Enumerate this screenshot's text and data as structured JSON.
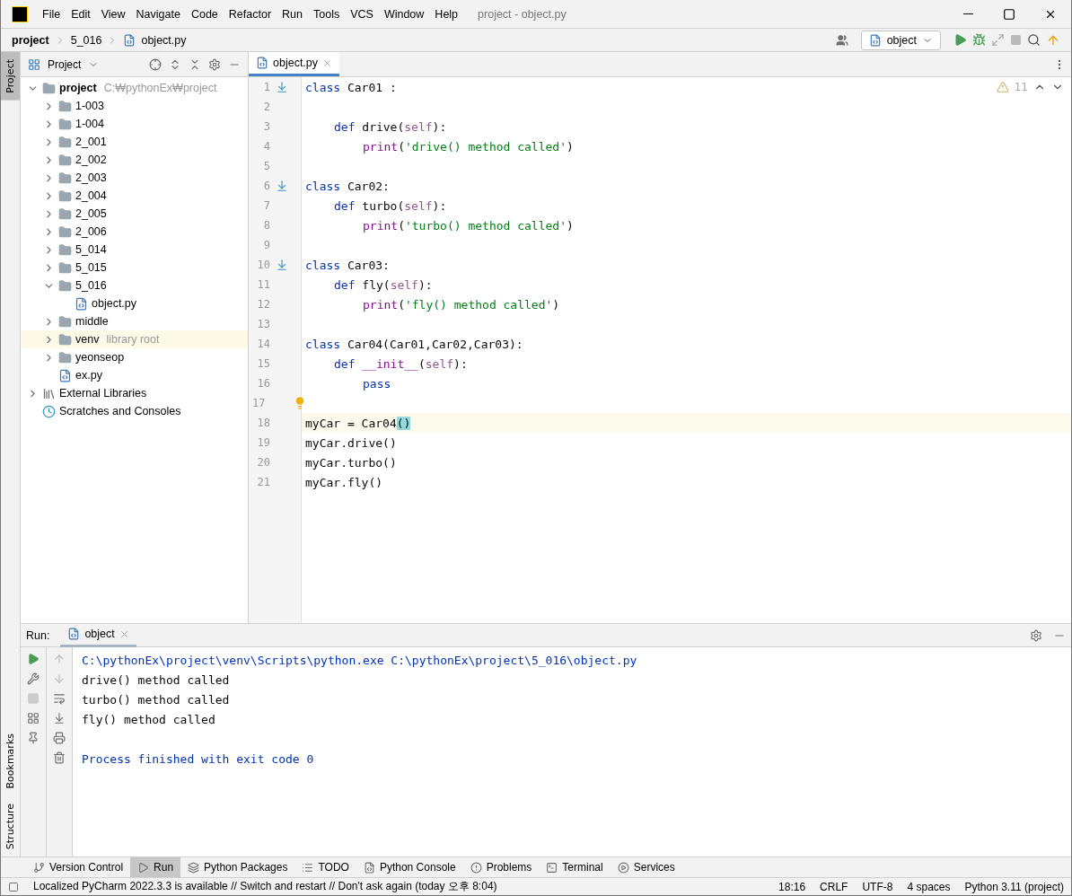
{
  "window": {
    "title": "project - object.py",
    "menu": [
      "File",
      "Edit",
      "View",
      "Navigate",
      "Code",
      "Refactor",
      "Run",
      "Tools",
      "VCS",
      "Window",
      "Help"
    ]
  },
  "breadcrumbs": [
    "project",
    "5_016",
    "object.py"
  ],
  "run_config": "object",
  "side_tabs_left": [
    {
      "label": "Project",
      "selected": true
    }
  ],
  "side_tabs_bottom": [
    "Bookmarks",
    "Structure"
  ],
  "project_panel": {
    "title": "Project",
    "tree": [
      {
        "kind": "folder",
        "name": "project",
        "hint": "C:₩pythonEx₩project",
        "expanded": true,
        "bold": true,
        "highlighted": false,
        "children": [
          {
            "kind": "folder",
            "name": "1-003",
            "expanded": false,
            "highlighted": false
          },
          {
            "kind": "folder",
            "name": "1-004",
            "expanded": false,
            "highlighted": false
          },
          {
            "kind": "folder",
            "name": "2_001",
            "expanded": false,
            "highlighted": false
          },
          {
            "kind": "folder",
            "name": "2_002",
            "expanded": false,
            "highlighted": false
          },
          {
            "kind": "folder",
            "name": "2_003",
            "expanded": false,
            "highlighted": false
          },
          {
            "kind": "folder",
            "name": "2_004",
            "expanded": false,
            "highlighted": false
          },
          {
            "kind": "folder",
            "name": "2_005",
            "expanded": false,
            "highlighted": false
          },
          {
            "kind": "folder",
            "name": "2_006",
            "expanded": false,
            "highlighted": false
          },
          {
            "kind": "folder",
            "name": "5_014",
            "expanded": false,
            "highlighted": false
          },
          {
            "kind": "folder",
            "name": "5_015",
            "expanded": false,
            "highlighted": false
          },
          {
            "kind": "folder",
            "name": "5_016",
            "expanded": true,
            "highlighted": false,
            "children": [
              {
                "kind": "python",
                "name": "object.py",
                "highlighted": false
              }
            ]
          },
          {
            "kind": "folder",
            "name": "middle",
            "expanded": false,
            "highlighted": false
          },
          {
            "kind": "folder",
            "name": "venv",
            "hint": "library root",
            "expanded": false,
            "highlighted": true
          },
          {
            "kind": "folder",
            "name": "yeonseop",
            "expanded": false,
            "highlighted": false
          },
          {
            "kind": "python",
            "name": "ex.py",
            "highlighted": false
          }
        ]
      },
      {
        "kind": "libraries",
        "name": "External Libraries",
        "expanded": false,
        "highlighted": false
      },
      {
        "kind": "scratches",
        "name": "Scratches and Consoles",
        "highlighted": false
      }
    ]
  },
  "editor": {
    "tabs": [
      {
        "label": "object.py",
        "selected": true
      }
    ],
    "warnings": "11",
    "lines": [
      {
        "number": "1",
        "kind": "top",
        "marker": true,
        "bulb": false,
        "current": false,
        "tokens": [
          {
            "kind": "keyword",
            "text": "class"
          },
          {
            "kind": "plain",
            "text": " Car01 :"
          }
        ]
      },
      {
        "number": "2",
        "marker": false,
        "bulb": false,
        "current": false
      },
      {
        "number": "3",
        "kind": "method",
        "marker": false,
        "bulb": false,
        "current": false,
        "tokens": [
          {
            "kind": "keyword",
            "text": "def"
          },
          {
            "kind": "plain",
            "text": " drive("
          },
          {
            "kind": "self",
            "text": "self"
          },
          {
            "kind": "plain",
            "text": "):"
          }
        ]
      },
      {
        "number": "4",
        "kind": "body",
        "marker": false,
        "bulb": false,
        "current": false,
        "tokens": [
          {
            "kind": "builtin",
            "text": "print"
          },
          {
            "kind": "plain",
            "text": "("
          },
          {
            "kind": "string",
            "text": "'drive() method called'"
          },
          {
            "kind": "plain",
            "text": ")"
          }
        ]
      },
      {
        "number": "5",
        "marker": false,
        "bulb": false,
        "current": false
      },
      {
        "number": "6",
        "kind": "top",
        "marker": true,
        "bulb": false,
        "current": false,
        "tokens": [
          {
            "kind": "keyword",
            "text": "class"
          },
          {
            "kind": "plain",
            "text": " Car02:"
          }
        ]
      },
      {
        "number": "7",
        "kind": "method",
        "marker": false,
        "bulb": false,
        "current": false,
        "tokens": [
          {
            "kind": "keyword",
            "text": "def"
          },
          {
            "kind": "plain",
            "text": " turbo("
          },
          {
            "kind": "self",
            "text": "self"
          },
          {
            "kind": "plain",
            "text": "):"
          }
        ]
      },
      {
        "number": "8",
        "kind": "body",
        "marker": false,
        "bulb": false,
        "current": false,
        "tokens": [
          {
            "kind": "builtin",
            "text": "print"
          },
          {
            "kind": "plain",
            "text": "("
          },
          {
            "kind": "string",
            "text": "'turbo() method called'"
          },
          {
            "kind": "plain",
            "text": ")"
          }
        ]
      },
      {
        "number": "9",
        "marker": false,
        "bulb": false,
        "current": false
      },
      {
        "number": "10",
        "kind": "top",
        "marker": true,
        "bulb": false,
        "current": false,
        "tokens": [
          {
            "kind": "keyword",
            "text": "class"
          },
          {
            "kind": "plain",
            "text": " Car03:"
          }
        ]
      },
      {
        "number": "11",
        "kind": "method",
        "marker": false,
        "bulb": false,
        "current": false,
        "tokens": [
          {
            "kind": "keyword",
            "text": "def"
          },
          {
            "kind": "plain",
            "text": " fly("
          },
          {
            "kind": "self",
            "text": "self"
          },
          {
            "kind": "plain",
            "text": "):"
          }
        ]
      },
      {
        "number": "12",
        "kind": "body",
        "marker": false,
        "bulb": false,
        "current": false,
        "tokens": [
          {
            "kind": "builtin",
            "text": "print"
          },
          {
            "kind": "plain",
            "text": "("
          },
          {
            "kind": "string",
            "text": "'fly() method called'"
          },
          {
            "kind": "plain",
            "text": ")"
          }
        ]
      },
      {
        "number": "13",
        "marker": false,
        "bulb": false,
        "current": false
      },
      {
        "number": "14",
        "kind": "top",
        "marker": false,
        "bulb": false,
        "current": false,
        "tokens": [
          {
            "kind": "keyword",
            "text": "class"
          },
          {
            "kind": "plain",
            "text": " Car04(Car01,Car02,Car03):"
          }
        ]
      },
      {
        "number": "15",
        "kind": "method",
        "marker": false,
        "bulb": false,
        "current": false,
        "tokens": [
          {
            "kind": "keyword",
            "text": "def"
          },
          {
            "kind": "builtin",
            "text": " __init__"
          },
          {
            "kind": "plain",
            "text": "("
          },
          {
            "kind": "self",
            "text": "self"
          },
          {
            "kind": "plain",
            "text": "):"
          }
        ]
      },
      {
        "number": "16",
        "kind": "body",
        "marker": false,
        "bulb": false,
        "current": false,
        "tokens": [
          {
            "kind": "keyword",
            "text": "pass"
          }
        ]
      },
      {
        "number": "17",
        "marker": false,
        "bulb": true,
        "current": false
      },
      {
        "number": "18",
        "kind": "top",
        "marker": false,
        "bulb": false,
        "current": true,
        "tokens": [
          {
            "kind": "plain",
            "text": "myCar = Car04"
          },
          {
            "kind": "match",
            "text": "()"
          }
        ]
      },
      {
        "number": "19",
        "kind": "top",
        "marker": false,
        "bulb": false,
        "current": false,
        "tokens": [
          {
            "kind": "plain",
            "text": "myCar.drive()"
          }
        ]
      },
      {
        "number": "20",
        "kind": "top",
        "marker": false,
        "bulb": false,
        "current": false,
        "tokens": [
          {
            "kind": "plain",
            "text": "myCar.turbo()"
          }
        ]
      },
      {
        "number": "21",
        "kind": "top",
        "marker": false,
        "bulb": false,
        "current": false,
        "tokens": [
          {
            "kind": "plain",
            "text": "myCar.fly()"
          }
        ]
      }
    ]
  },
  "run_panel": {
    "label": "Run:",
    "tabs": [
      {
        "label": "object",
        "selected": true
      }
    ],
    "output": [
      {
        "kind": "system",
        "text": "C:\\pythonEx\\project\\venv\\Scripts\\python.exe C:\\pythonEx\\project\\5_016\\object.py"
      },
      {
        "kind": "stdout",
        "text": "drive() method called"
      },
      {
        "kind": "stdout",
        "text": "turbo() method called"
      },
      {
        "kind": "stdout",
        "text": "fly() method called"
      },
      {
        "kind": "exit",
        "text": "Process finished with exit code 0"
      }
    ]
  },
  "tool_tabs": [
    {
      "kind": "vcs",
      "label": "Version Control",
      "selected": false
    },
    {
      "kind": "run",
      "label": "Run",
      "selected": true
    },
    {
      "kind": "packages",
      "label": "Python Packages",
      "selected": false
    },
    {
      "kind": "todo",
      "label": "TODO",
      "selected": false
    },
    {
      "kind": "console",
      "label": "Python Console",
      "selected": false
    },
    {
      "kind": "problems",
      "label": "Problems",
      "selected": false
    },
    {
      "kind": "terminal",
      "label": "Terminal",
      "selected": false
    },
    {
      "kind": "services",
      "label": "Services",
      "selected": false
    }
  ],
  "status_bar": {
    "message": "Localized PyCharm 2022.3.3 is available // Switch and restart // Don't ask again (today 오후 8:04)",
    "items": [
      "18:16",
      "CRLF",
      "UTF-8",
      "4 spaces",
      "Python 3.11 (project)"
    ]
  }
}
